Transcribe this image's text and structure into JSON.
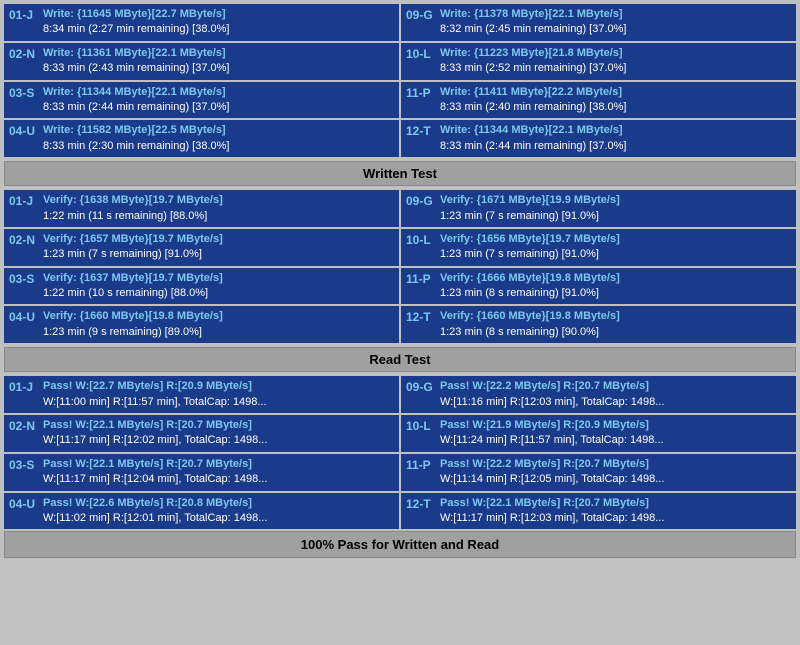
{
  "writeSection": {
    "rows": [
      {
        "left": {
          "id": "01-J",
          "line1": "Write: {11645 MByte}[22.7 MByte/s]",
          "line2": "8:34 min (2:27 min remaining)  [38.0%]"
        },
        "right": {
          "id": "09-G",
          "line1": "Write: {11378 MByte}[22.1 MByte/s]",
          "line2": "8:32 min (2:45 min remaining)  [37.0%]"
        }
      },
      {
        "left": {
          "id": "02-N",
          "line1": "Write: {11361 MByte}[22.1 MByte/s]",
          "line2": "8:33 min (2:43 min remaining)  [37.0%]"
        },
        "right": {
          "id": "10-L",
          "line1": "Write: {11223 MByte}[21.8 MByte/s]",
          "line2": "8:33 min (2:52 min remaining)  [37.0%]"
        }
      },
      {
        "left": {
          "id": "03-S",
          "line1": "Write: {11344 MByte}[22.1 MByte/s]",
          "line2": "8:33 min (2:44 min remaining)  [37.0%]"
        },
        "right": {
          "id": "11-P",
          "line1": "Write: {11411 MByte}[22.2 MByte/s]",
          "line2": "8:33 min (2:40 min remaining)  [38.0%]"
        }
      },
      {
        "left": {
          "id": "04-U",
          "line1": "Write: {11582 MByte}[22.5 MByte/s]",
          "line2": "8:33 min (2:30 min remaining)  [38.0%]"
        },
        "right": {
          "id": "12-T",
          "line1": "Write: {11344 MByte}[22.1 MByte/s]",
          "line2": "8:33 min (2:44 min remaining)  [37.0%]"
        }
      }
    ],
    "header": "Written Test"
  },
  "verifySection": {
    "rows": [
      {
        "left": {
          "id": "01-J",
          "line1": "Verify: {1638 MByte}[19.7 MByte/s]",
          "line2": "1:22 min (11 s remaining)  [88.0%]"
        },
        "right": {
          "id": "09-G",
          "line1": "Verify: {1671 MByte}[19.9 MByte/s]",
          "line2": "1:23 min (7 s remaining)  [91.0%]"
        }
      },
      {
        "left": {
          "id": "02-N",
          "line1": "Verify: {1657 MByte}[19.7 MByte/s]",
          "line2": "1:23 min (7 s remaining)  [91.0%]"
        },
        "right": {
          "id": "10-L",
          "line1": "Verify: {1656 MByte}[19.7 MByte/s]",
          "line2": "1:23 min (7 s remaining)  [91.0%]"
        }
      },
      {
        "left": {
          "id": "03-S",
          "line1": "Verify: {1637 MByte}[19.7 MByte/s]",
          "line2": "1:22 min (10 s remaining)  [88.0%]"
        },
        "right": {
          "id": "11-P",
          "line1": "Verify: {1666 MByte}[19.8 MByte/s]",
          "line2": "1:23 min (8 s remaining)  [91.0%]"
        }
      },
      {
        "left": {
          "id": "04-U",
          "line1": "Verify: {1660 MByte}[19.8 MByte/s]",
          "line2": "1:23 min (9 s remaining)  [89.0%]"
        },
        "right": {
          "id": "12-T",
          "line1": "Verify: {1660 MByte}[19.8 MByte/s]",
          "line2": "1:23 min (8 s remaining)  [90.0%]"
        }
      }
    ],
    "header": "Read Test"
  },
  "passSection": {
    "rows": [
      {
        "left": {
          "id": "01-J",
          "line1": "Pass! W:[22.7 MByte/s] R:[20.9 MByte/s]",
          "line2": "W:[11:00 min] R:[11:57 min], TotalCap: 1498..."
        },
        "right": {
          "id": "09-G",
          "line1": "Pass! W:[22.2 MByte/s] R:[20.7 MByte/s]",
          "line2": "W:[11:16 min] R:[12:03 min], TotalCap: 1498..."
        }
      },
      {
        "left": {
          "id": "02-N",
          "line1": "Pass! W:[22.1 MByte/s] R:[20.7 MByte/s]",
          "line2": "W:[11:17 min] R:[12:02 min], TotalCap: 1498..."
        },
        "right": {
          "id": "10-L",
          "line1": "Pass! W:[21.9 MByte/s] R:[20.9 MByte/s]",
          "line2": "W:[11:24 min] R:[11:57 min], TotalCap: 1498..."
        }
      },
      {
        "left": {
          "id": "03-S",
          "line1": "Pass! W:[22.1 MByte/s] R:[20.7 MByte/s]",
          "line2": "W:[11:17 min] R:[12:04 min], TotalCap: 1498..."
        },
        "right": {
          "id": "11-P",
          "line1": "Pass! W:[22.2 MByte/s] R:[20.7 MByte/s]",
          "line2": "W:[11:14 min] R:[12:05 min], TotalCap: 1498..."
        }
      },
      {
        "left": {
          "id": "04-U",
          "line1": "Pass! W:[22.6 MByte/s] R:[20.8 MByte/s]",
          "line2": "W:[11:02 min] R:[12:01 min], TotalCap: 1498..."
        },
        "right": {
          "id": "12-T",
          "line1": "Pass! W:[22.1 MByte/s] R:[20.7 MByte/s]",
          "line2": "W:[11:17 min] R:[12:03 min], TotalCap: 1498..."
        }
      }
    ]
  },
  "footer": "100% Pass for Written and Read"
}
